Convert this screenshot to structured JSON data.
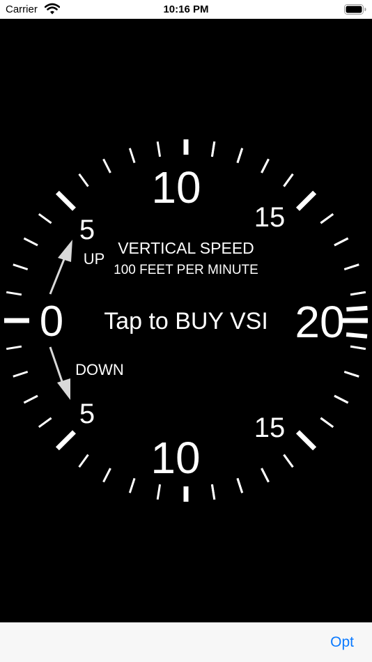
{
  "status_bar": {
    "carrier": "Carrier",
    "time": "10:16 PM",
    "wifi_icon": "wifi-icon",
    "battery_icon": "battery-icon"
  },
  "gauge": {
    "title": "VERTICAL SPEED",
    "subtitle": "100 FEET PER MINUTE",
    "up_label": "UP",
    "down_label": "DOWN",
    "center_message": "Tap to BUY VSI",
    "labels": {
      "zero": "0",
      "up_5": "5",
      "up_10": "10",
      "up_15": "15",
      "twenty": "20",
      "down_5": "5",
      "down_10": "10",
      "down_15": "15"
    },
    "colors": {
      "dial": "#000000",
      "markings": "#ffffff",
      "needles": "#d9d9d9"
    }
  },
  "toolbar": {
    "opt_label": "Opt",
    "accent": "#0a7aff"
  }
}
